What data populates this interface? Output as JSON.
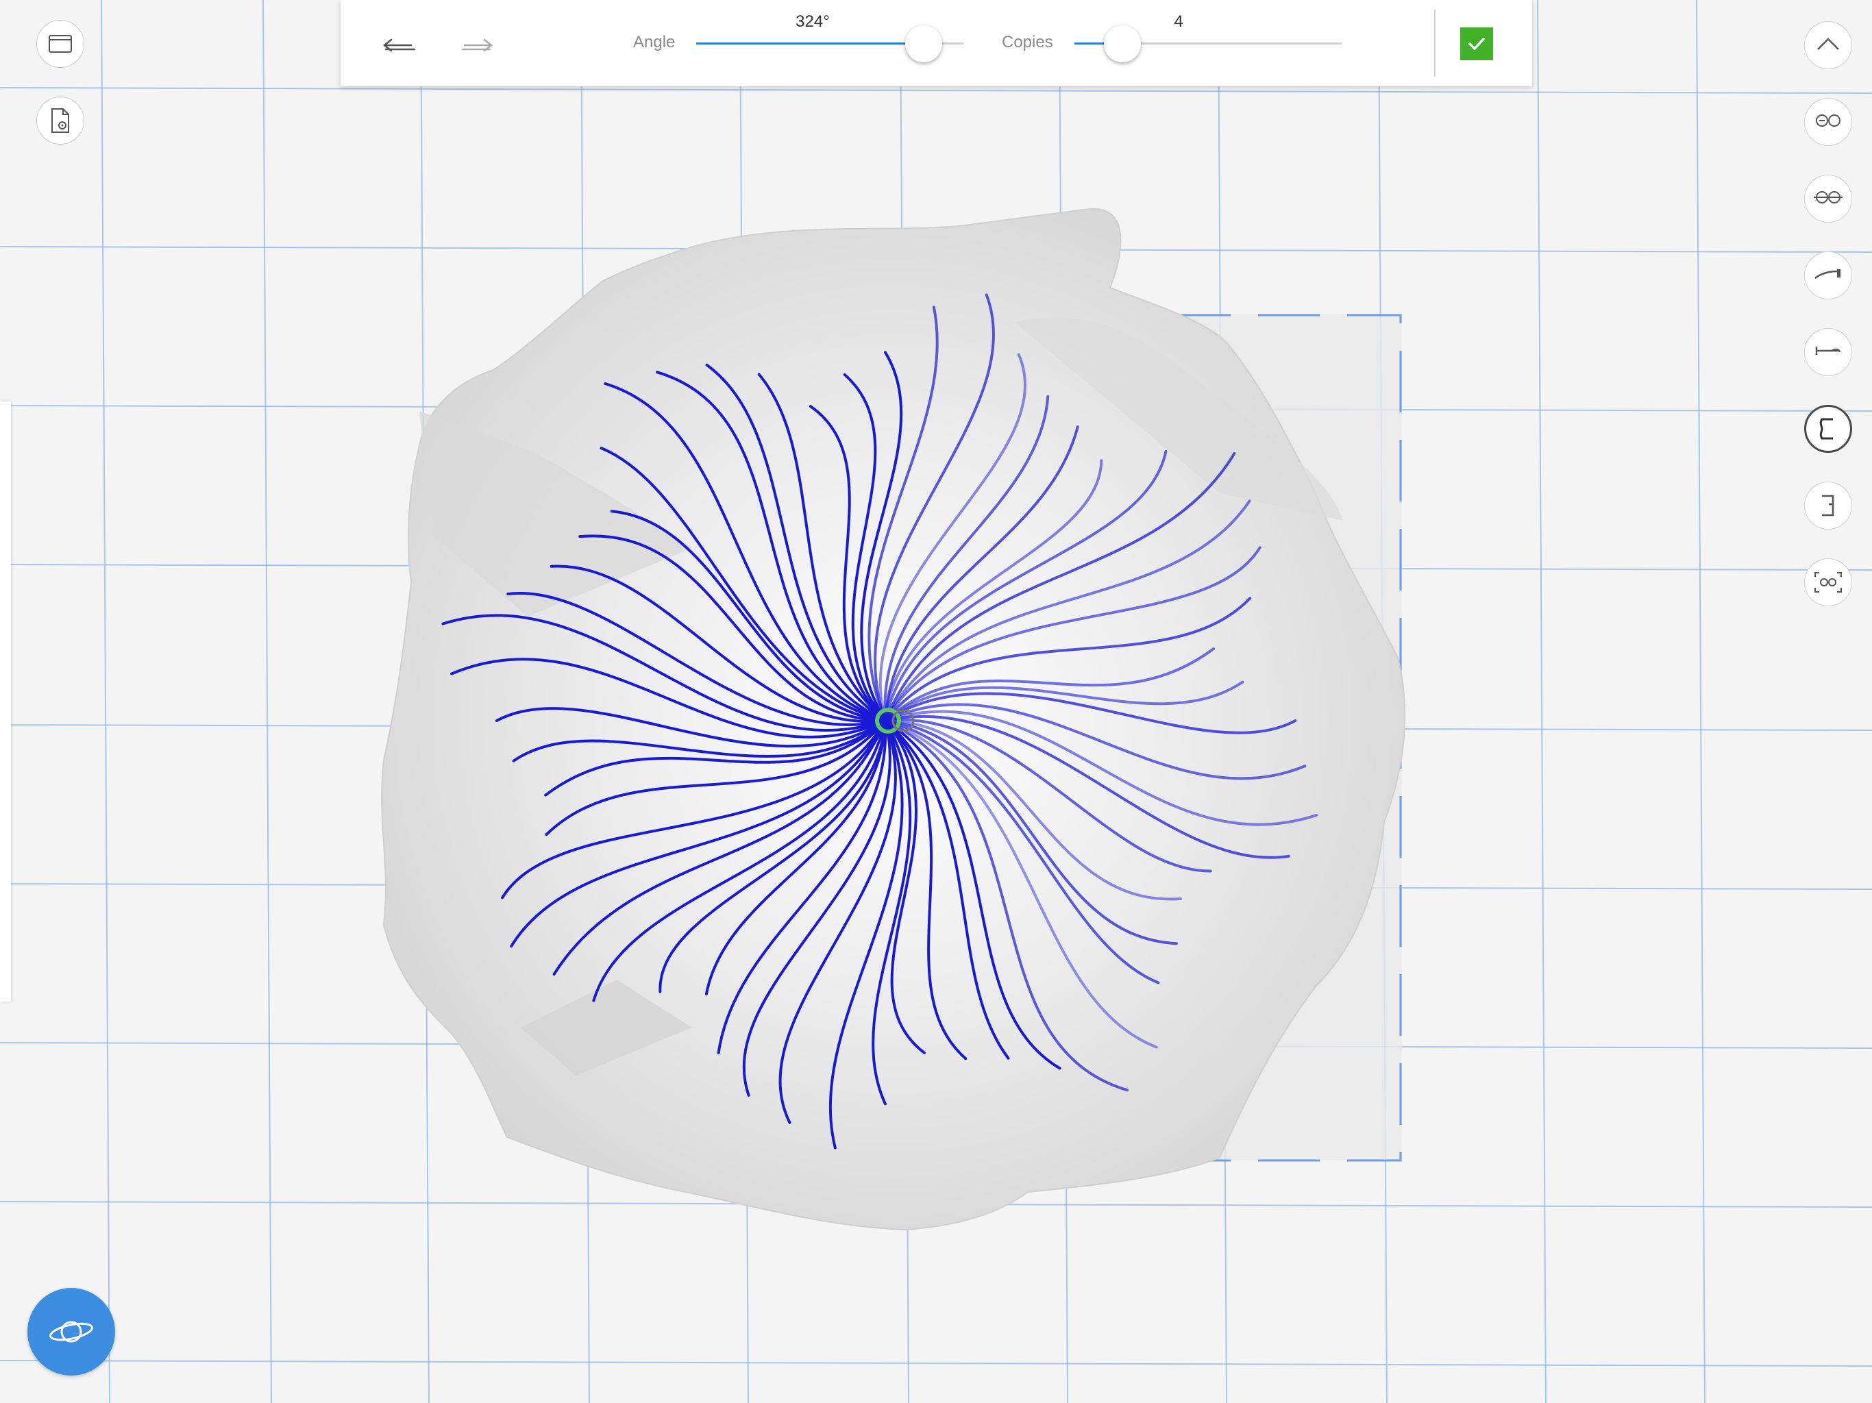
{
  "toolbar": {
    "angle": {
      "label": "Angle",
      "value": "324°",
      "fraction": 0.85
    },
    "copies": {
      "label": "Copies",
      "value": "4",
      "fraction": 0.18
    },
    "accent_color": "#2b7fd6",
    "confirm_color": "#43b02a"
  },
  "left_buttons": [
    "window-icon",
    "document-settings-icon"
  ],
  "right_buttons": [
    "chevron-up-icon",
    "symmetry-icon",
    "symmetry-mirror-icon",
    "lasso-tool-icon",
    "pin-tool-icon",
    "bracket-left-icon",
    "bracket-right-icon",
    "fit-view-icon"
  ],
  "active_right_button": 5,
  "orbit_button": "orbit-icon",
  "colors": {
    "background": "#f4f4f4",
    "grid": "#8fb6ec",
    "curves": "#1a1ad6",
    "surface": "#e2e2e2"
  }
}
